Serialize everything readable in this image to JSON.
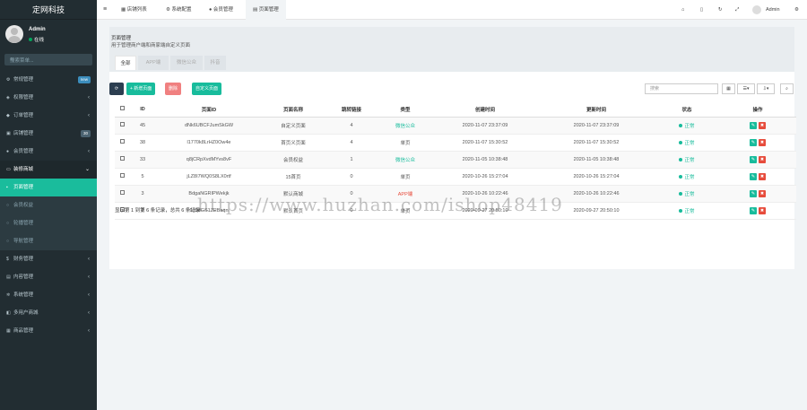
{
  "sidebar": {
    "logo": "定网科技",
    "user": {
      "name": "Admin",
      "status": "在线"
    },
    "search_placeholder": "搜索菜单...",
    "items": [
      {
        "label": "常规管理",
        "icon": "cog-icon",
        "badge": "new"
      },
      {
        "label": "权限管理",
        "icon": "group-icon"
      },
      {
        "label": "订单管理",
        "icon": "cart-icon"
      },
      {
        "label": "店铺管理",
        "icon": "shop-icon",
        "badge": "30"
      },
      {
        "label": "会员管理",
        "icon": "user-icon"
      },
      {
        "label": "装修商城",
        "icon": "desktop-icon"
      },
      {
        "label": "页面管理",
        "icon": "page-icon"
      },
      {
        "label": "会员权益",
        "icon": "circle-icon"
      },
      {
        "label": "轮播管理",
        "icon": "circle-icon"
      },
      {
        "label": "导航管理",
        "icon": "circle-icon"
      },
      {
        "label": "财务管理",
        "icon": "money-icon"
      },
      {
        "label": "内容管理",
        "icon": "file-icon"
      },
      {
        "label": "系统管理",
        "icon": "gear-icon"
      },
      {
        "label": "多用户商城",
        "icon": "store-icon"
      },
      {
        "label": "商品管理",
        "icon": "box-icon"
      }
    ]
  },
  "topbar": {
    "tabs": [
      "店铺列表",
      "系统配置",
      "会员管理",
      "页面管理"
    ],
    "admin": "Admin"
  },
  "page": {
    "title": "页面管理",
    "desc": "用于管理商户端和商家端自定义页面",
    "tabs": [
      "全部",
      "APP端",
      "微信公众",
      "抖音"
    ]
  },
  "toolbar": {
    "refresh": "⟳",
    "add": "+ 新增页面",
    "delete": "删除",
    "export": "自定义页面",
    "search_placeholder": "搜索"
  },
  "table": {
    "headers": [
      "ID",
      "页面ID",
      "页面名称",
      "跳转链接",
      "类型",
      "创建时间",
      "更新时间",
      "状态",
      "操作"
    ],
    "rows": [
      {
        "id": "45",
        "pid": "dNk6UBCFJumSkGW",
        "name": "自定义页面",
        "link": "4",
        "type": "微信公众",
        "type_color": "green",
        "created": "2020-11-07 23:37:09",
        "updated": "2020-11-07 23:37:09",
        "status": "正常"
      },
      {
        "id": "38",
        "pid": "l1770k8LrHZ0Ow4e",
        "name": "首页义页面",
        "link": "4",
        "type": "单页",
        "type_color": "",
        "created": "2020-11-07 15:30:52",
        "updated": "2020-11-07 15:30:52",
        "status": "正常"
      },
      {
        "id": "33",
        "pid": "q8jCRpXvdMYvs8vF",
        "name": "会员权益",
        "link": "1",
        "type": "微信公众",
        "type_color": "green",
        "created": "2020-11-05 10:38:48",
        "updated": "2020-11-05 10:38:48",
        "status": "正常"
      },
      {
        "id": "5",
        "pid": "jLZ8I7WQ0S8LX0rtf",
        "name": "15首页",
        "link": "0",
        "type": "单页",
        "type_color": "",
        "created": "2020-10-26 15:27:04",
        "updated": "2020-10-26 15:27:04",
        "status": "正常"
      },
      {
        "id": "3",
        "pid": "BdgaNGRIPWekjk",
        "name": "默认商城",
        "link": "0",
        "type": "APP端",
        "type_color": "red",
        "created": "2020-10-26 10:22:46",
        "updated": "2020-10-26 10:22:46",
        "status": "正常"
      },
      {
        "id": "2",
        "pid": "910dGS1ZEBaqn",
        "name": "默认首页",
        "link": "0",
        "type": "单页",
        "type_color": "",
        "created": "2020-09-27 20:50:10",
        "updated": "2020-09-27 20:50:10",
        "status": "正常"
      }
    ],
    "footer": "显示第 1 到第 6 条记录，总共 6 条记录"
  },
  "watermark": "https://www.huzhan.com/ishop48419",
  "colors": {
    "accent": "#18bc9c",
    "danger": "#e74c3c",
    "primary": "#2c3e50"
  }
}
